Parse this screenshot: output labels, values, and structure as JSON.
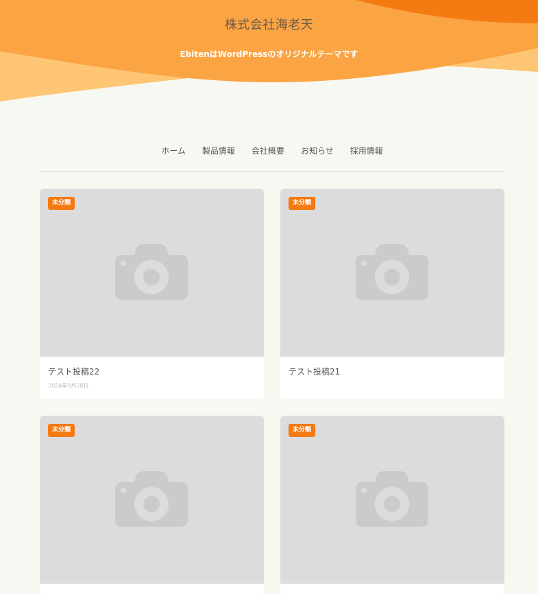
{
  "header": {
    "site_title": "株式会社海老天",
    "tagline": "EbitenはWordPressのオリジナルテーマです",
    "colors": {
      "wave_dark": "#f47a12",
      "wave_mid": "#fba443",
      "wave_light": "#fec574"
    }
  },
  "nav": {
    "items": [
      "ホーム",
      "製品情報",
      "会社概要",
      "お知らせ",
      "採用情報"
    ]
  },
  "posts": [
    {
      "category": "未分類",
      "title": "テスト投稿22",
      "date": "2024年9月28日"
    },
    {
      "category": "未分類",
      "title": "テスト投稿21",
      "date": ""
    },
    {
      "category": "未分類",
      "title": "",
      "date": ""
    },
    {
      "category": "未分類",
      "title": "",
      "date": ""
    }
  ],
  "icons": {
    "thumbnail_placeholder": "camera-icon"
  },
  "accent_color": "#f47a12"
}
